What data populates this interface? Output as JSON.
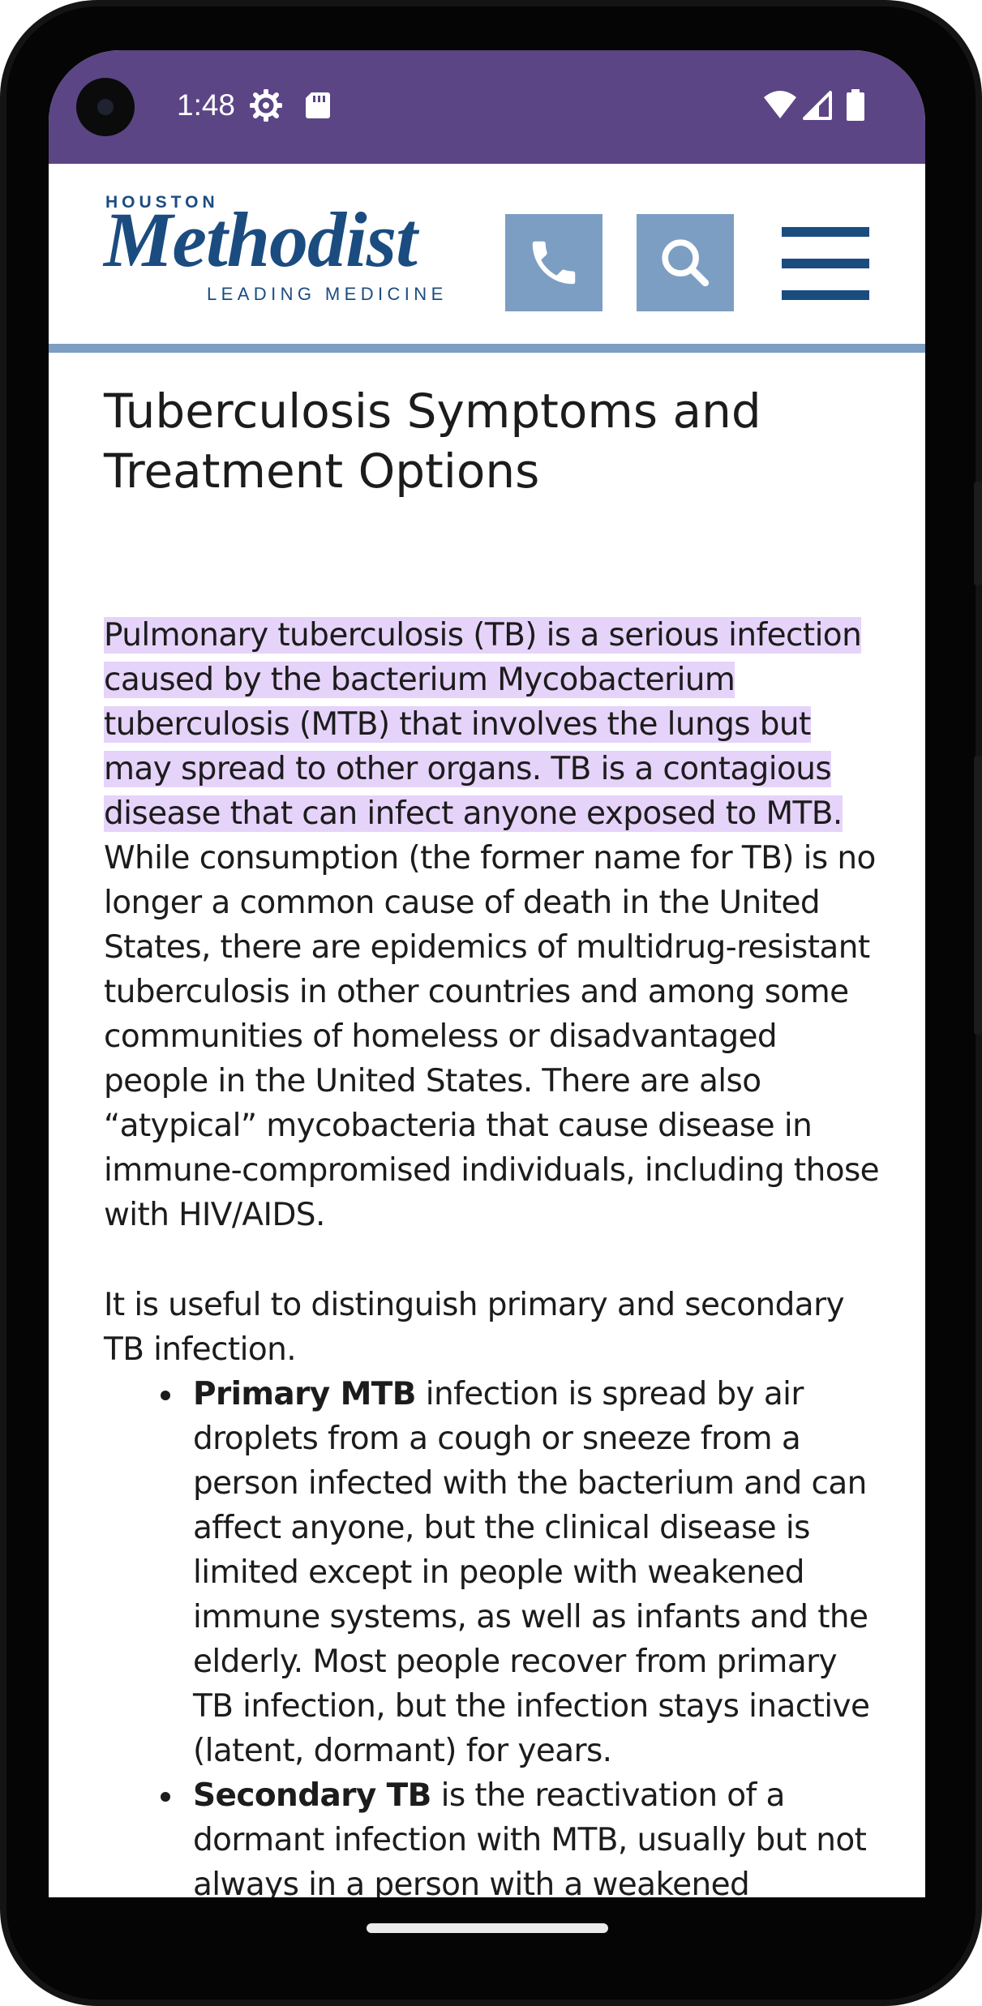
{
  "status_bar": {
    "time": "1:48",
    "left_icons": [
      "settings-gear-icon",
      "sd-card-icon"
    ],
    "right_icons": [
      "wifi-icon",
      "cellular-signal-icon",
      "battery-icon"
    ],
    "background": "#5b4585"
  },
  "header": {
    "logo": {
      "top": "HOUSTON",
      "main": "Methodist",
      "sub": "LEADING MEDICINE"
    },
    "buttons": [
      "phone-icon",
      "search-icon",
      "hamburger-menu-icon"
    ],
    "brand_color": "#1b4c80",
    "button_color": "#7c9ec2"
  },
  "article": {
    "title": "Tuberculosis Symptoms and Treatment Options",
    "intro_highlighted": "Pulmonary tuberculosis (TB) is a serious infection caused by the bacterium Mycobacterium tuberculosis (MTB) that involves the lungs but may spread to other organs. TB is a contagious disease that can infect anyone exposed to MTB.",
    "intro_rest": " While consumption (the former name for TB) is no longer a common cause of death in the United States, there are epidemics of multidrug-resistant tuberculosis in other countries and among some communities of homeless or disadvantaged people in the United States. There are also “atypical” mycobacteria that cause disease in immune-compromised individuals, including those with HIV/AIDS.",
    "highlight_color": "#e6d3fa",
    "distinguish": "It is useful to distinguish primary and secondary TB infection.",
    "bullets": [
      {
        "term": "Primary MTB",
        "text": " infection is spread by air droplets from a cough or sneeze from a person infected with the bacterium and can affect anyone, but the clinical disease is limited except in people with weakened immune systems, as well as infants and the elderly. Most people recover from primary TB infection, but the infection stays inactive (latent, dormant) for years."
      },
      {
        "term": "Secondary TB",
        "text": " is the reactivation of a dormant infection with MTB, usually but not always in a person with a weakened immune"
      }
    ]
  }
}
